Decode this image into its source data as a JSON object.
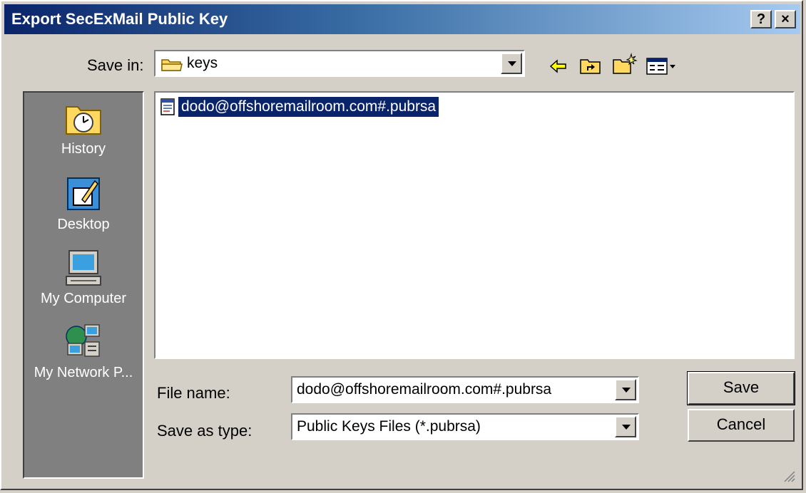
{
  "window": {
    "title": "Export SecExMail Public Key"
  },
  "titlebar_buttons": {
    "help": "?",
    "close": "×"
  },
  "save_in": {
    "label": "Save in:",
    "value": "keys"
  },
  "toolbar_icons": [
    "back-icon",
    "up-folder-icon",
    "new-folder-icon",
    "view-menu-icon"
  ],
  "places": [
    {
      "label": "History",
      "icon": "history-icon"
    },
    {
      "label": "Desktop",
      "icon": "desktop-icon"
    },
    {
      "label": "My Computer",
      "icon": "my-computer-icon"
    },
    {
      "label": "My Network P...",
      "icon": "network-icon"
    }
  ],
  "files": [
    {
      "name": "dodo@offshoremailroom.com#.pubrsa",
      "selected": true
    }
  ],
  "file_name": {
    "label": "File name:",
    "value": "dodo@offshoremailroom.com#.pubrsa"
  },
  "save_as_type": {
    "label": "Save as type:",
    "value": "Public Keys Files (*.pubrsa)"
  },
  "buttons": {
    "save": "Save",
    "cancel": "Cancel"
  },
  "colors": {
    "selection": "#0a246a",
    "face": "#d4d0c8",
    "title_start": "#0a246a",
    "title_end": "#a6caf0"
  }
}
